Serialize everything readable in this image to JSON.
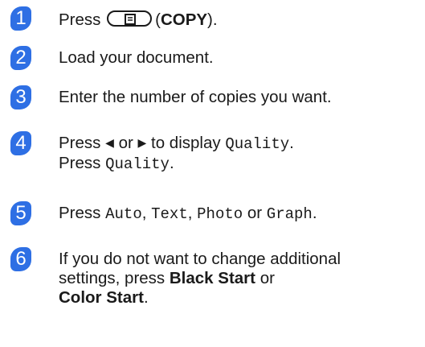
{
  "steps": [
    {
      "n": "1",
      "press": "Press",
      "copy": "COPY",
      "open": "(",
      "close": ")."
    },
    {
      "n": "2",
      "text": "Load your document."
    },
    {
      "n": "3",
      "text": "Enter the number of copies you want."
    },
    {
      "n": "4",
      "press": "Press",
      "or": "or",
      "to_display": "to display",
      "quality": "Quality",
      "press2": "Press",
      "quality2": "Quality"
    },
    {
      "n": "5",
      "press": "Press",
      "auto": "Auto",
      "text_opt": "Text",
      "photo": "Photo",
      "or": "or",
      "graph": "Graph"
    },
    {
      "n": "6",
      "line1": "If you do not want to change additional",
      "line2a": "settings, press",
      "black_start": "Black Start",
      "or": "or",
      "color_start": "Color Start"
    }
  ]
}
